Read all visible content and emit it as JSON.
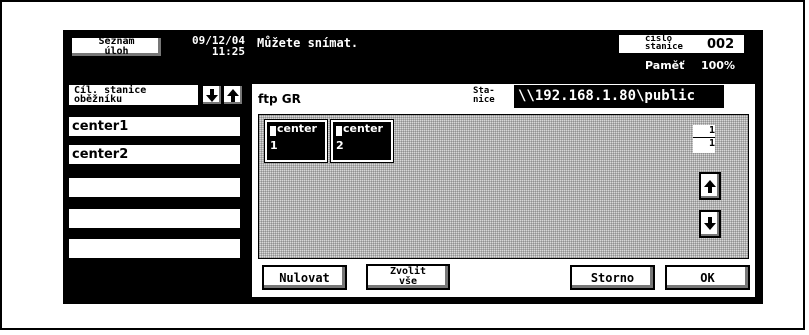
{
  "header": {
    "job_list_label_line1": "Seznam",
    "job_list_label_line2": "úloh",
    "date": "09/12/04",
    "time": "11:25",
    "status_message": "Můžete snímat.",
    "station_number_label_line1": "číslo",
    "station_number_label_line2": "stanice",
    "station_number": "002",
    "memory_label": "Paměť",
    "memory_value": "100%"
  },
  "sidebar": {
    "title_line1": "Cíl. stanice",
    "title_line2": "oběžníku",
    "items": [
      {
        "label": "center1"
      },
      {
        "label": "center2"
      },
      {
        "label": ""
      },
      {
        "label": ""
      },
      {
        "label": ""
      }
    ]
  },
  "main": {
    "destination_name": "ftp GR",
    "station_label_line1": "Sta-",
    "station_label_line2": "nice",
    "station_path": "\\\\192.168.1.80\\public",
    "destinations": [
      {
        "name": "center",
        "number": "1"
      },
      {
        "name": "center",
        "number": "2"
      }
    ],
    "page_current": "1",
    "page_total": "1"
  },
  "footer": {
    "reset_label": "Nulovat",
    "select_all_line1": "Zvolit",
    "select_all_line2": "vše",
    "cancel_label": "Storno",
    "ok_label": "OK"
  },
  "icons": {
    "sidebar_down": "arrow-down-icon",
    "sidebar_up": "arrow-up-icon",
    "scroll_up": "arrow-up-icon",
    "scroll_down": "arrow-down-icon",
    "destination_glyph": "destination-icon"
  }
}
